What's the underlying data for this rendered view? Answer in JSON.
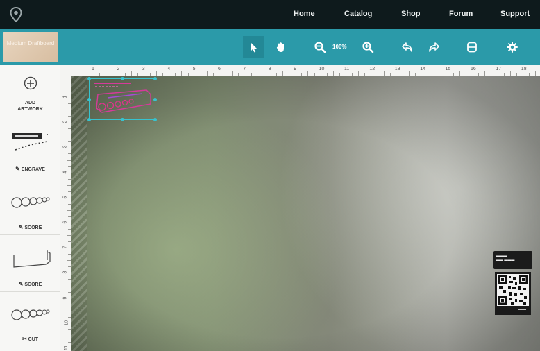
{
  "nav": {
    "logo_icon": "pin-logo-icon",
    "links": [
      "Home",
      "Catalog",
      "Shop",
      "Forum",
      "Support"
    ]
  },
  "toolbar": {
    "material_label": "Medium Draftboard",
    "tools": [
      "select-arrow-icon",
      "pan-hand-icon",
      "zoom-out-icon",
      "zoom-in-icon",
      "undo-icon",
      "redo-icon",
      "material-icon",
      "settings-gear-icon"
    ],
    "zoom_value": "100%",
    "accent": "#2b9aa9"
  },
  "sidebar": {
    "add_label": "Add Artwork",
    "items": [
      {
        "thumbnail": "engrave-artwork-thumbnail",
        "action": "Engrave",
        "action_icon": "pencil-icon"
      },
      {
        "thumbnail": "circles-artwork-thumbnail",
        "action": "Score",
        "action_icon": "pencil-icon"
      },
      {
        "thumbnail": "outline-artwork-thumbnail",
        "action": "Score",
        "action_icon": "pencil-icon"
      },
      {
        "thumbnail": "circles-artwork-thumbnail",
        "action": "Cut",
        "action_icon": "scissors-icon"
      }
    ]
  },
  "ruler": {
    "top_numbers": [
      "1",
      "2",
      "3",
      "4",
      "5",
      "6",
      "7",
      "8",
      "9",
      "10",
      "11",
      "12",
      "13",
      "14",
      "15",
      "16",
      "17",
      "18"
    ],
    "left_numbers": [
      "1",
      "2",
      "3",
      "4",
      "5",
      "6",
      "7",
      "8",
      "9",
      "10",
      "11"
    ]
  },
  "canvas": {
    "selection_color": "#37c3cf",
    "artwork_color": "#e0338e"
  }
}
